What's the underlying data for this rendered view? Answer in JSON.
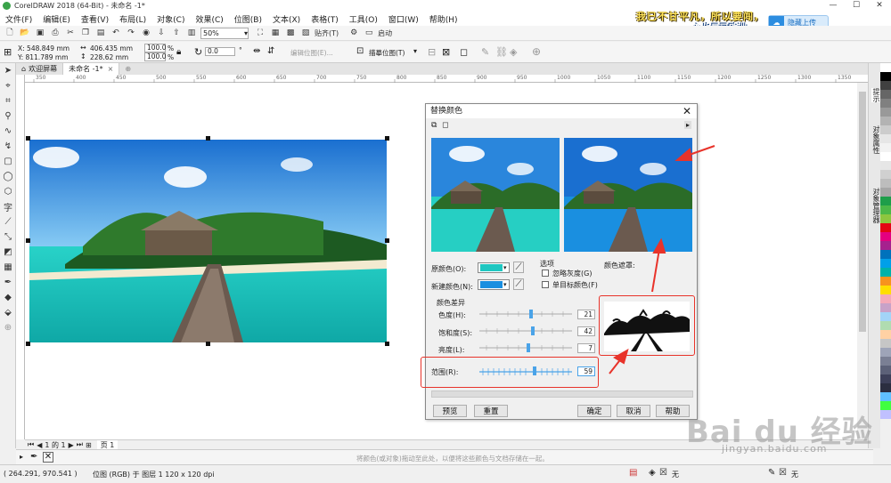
{
  "window": {
    "title": "CorelDRAW 2018 (64-Bit) - 未命名 -1*",
    "controls": [
      "—",
      "☐",
      "✕"
    ]
  },
  "menu": [
    "文件(F)",
    "编辑(E)",
    "查看(V)",
    "布局(L)",
    "对象(C)",
    "效果(C)",
    "位图(B)",
    "文本(X)",
    "表格(T)",
    "工具(O)",
    "窗口(W)",
    "帮助(H)"
  ],
  "banner": {
    "line1": "我已不甘平凡，所以要闯，",
    "line2": "心也早已欧洲"
  },
  "cloud_button": "隐藏上传",
  "toolbar": {
    "zoom": "50%",
    "snap": "贴齐(T)",
    "launch": "启动"
  },
  "propbar": {
    "x": "X: 548.849 mm",
    "y": "Y: 811.789 mm",
    "w": "406.435 mm",
    "h": "228.62 mm",
    "sx": "100.0",
    "sy": "100.0",
    "pct": "%",
    "angle": "0.0",
    "deg": "°",
    "edit_bitmap": "编辑位图(E)...",
    "trace_bitmap": "描摹位图(T)"
  },
  "tabs": [
    "欢迎屏幕",
    "未命名 -1*"
  ],
  "ruler_labels": [
    "350",
    "400",
    "450",
    "500",
    "550",
    "600",
    "650",
    "700",
    "750",
    "800",
    "850",
    "900",
    "950",
    "1000",
    "1050",
    "1100",
    "1150",
    "1200",
    "1250",
    "1300",
    "1350"
  ],
  "right_dock": [
    "提示",
    "对象属性",
    "对象管理器"
  ],
  "dialog": {
    "title": "替换颜色",
    "original_label": "原颜色(O):",
    "new_label": "新建颜色(N):",
    "original_color": "#1fc7c1",
    "new_color": "#1a8fe0",
    "options_title": "选项",
    "ignore_gray": "忽略灰度(G)",
    "single_target": "单目标颜色(F)",
    "mask_label": "颜色遮罩:",
    "diff_title": "颜色差异",
    "hue_label": "色度(H):",
    "hue_value": "21",
    "sat_label": "饱和度(S):",
    "sat_value": "42",
    "light_label": "亮度(L):",
    "light_value": "7",
    "range_label": "范围(R):",
    "range_value": "59",
    "buttons": {
      "preview": "预览",
      "reset": "重置",
      "ok": "确定",
      "cancel": "取消",
      "help": "帮助"
    }
  },
  "pagebar": {
    "page_of": "1 的 1",
    "page_tab": "页 1"
  },
  "colorbar_hint": "将颜色(或对象)拖动至此处，以便将这些颜色与文档存储在一起。",
  "status": {
    "cursor": "( 264.291, 970.541 )",
    "info": "位图 (RGB) 于 图层 1 120 x 120 dpi",
    "fill": "无",
    "outline": "无"
  },
  "watermark": {
    "main": "Bai du 经验",
    "url": "jingyan.baidu.com"
  },
  "palette": [
    "#ffffff",
    "#000000",
    "#404040",
    "#666666",
    "#808080",
    "#999999",
    "#b3b3b3",
    "#cccccc",
    "#e6e6e6",
    "#f2f2f2",
    "#ffffff",
    "#e6e6e6",
    "#d0d0d0",
    "#bdbdbd",
    "#a6a6a6",
    "#1e9e4a",
    "#4cb848",
    "#8dc63f",
    "#e30613",
    "#e4007f",
    "#a6218e",
    "#0072bc",
    "#00a0e9",
    "#00b2a9",
    "#f7931e",
    "#ffde00",
    "#f5a9b8",
    "#c8a2c8",
    "#a3d4f7",
    "#b0dcb0",
    "#ffd1a4",
    "#c6c6c6",
    "#9ea4b8",
    "#7a7f94",
    "#5c6178",
    "#3d4059",
    "#2b2e40",
    "#60c0ff",
    "#40ff40",
    "#c0c0ff"
  ]
}
